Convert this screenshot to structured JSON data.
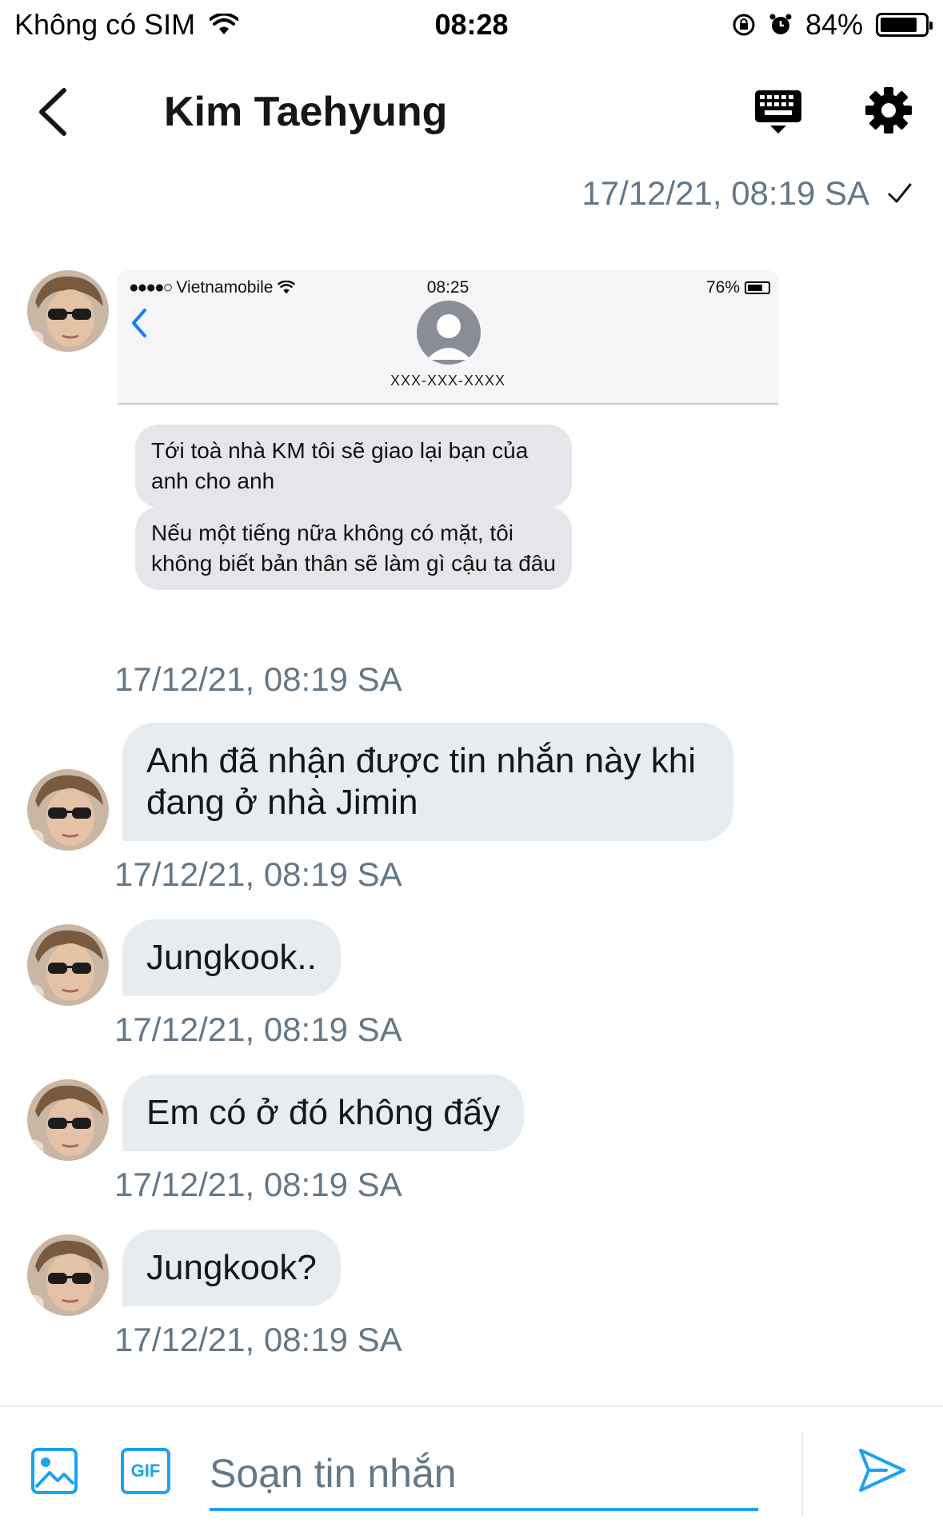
{
  "statusbar": {
    "carrier": "Không có SIM",
    "time": "08:28",
    "battery": "84%",
    "battery_level": 0.84
  },
  "header": {
    "title": "Kim Taehyung"
  },
  "sent_timestamp": "17/12/21, 08:19 SA",
  "screenshot": {
    "carrier": "Vietnamobile",
    "time": "08:25",
    "battery": "76%",
    "number": "XXX-XXX-XXXX",
    "messages": [
      "Tới toà nhà KM tôi sẽ giao lại bạn của anh cho anh",
      "Nếu một tiếng nữa không có mặt, tôi không biết bản thân sẽ làm gì cậu ta đâu"
    ]
  },
  "messages": [
    {
      "timestamp": "17/12/21, 08:19 SA"
    },
    {
      "text": "Anh đã nhận được tin nhắn này khi đang ở nhà Jimin",
      "timestamp": "17/12/21, 08:19 SA"
    },
    {
      "text": "Jungkook..",
      "timestamp": "17/12/21, 08:19 SA"
    },
    {
      "text": "Em có ở đó không đấy",
      "timestamp": "17/12/21, 08:19 SA"
    },
    {
      "text": "Jungkook?",
      "timestamp": "17/12/21, 08:19 SA"
    }
  ],
  "composer": {
    "placeholder": "Soạn tin nhắn",
    "gif_label": "GIF"
  },
  "colors": {
    "accent": "#1da1f2",
    "bubble": "#e6ecf0",
    "timestamp": "#657786"
  }
}
